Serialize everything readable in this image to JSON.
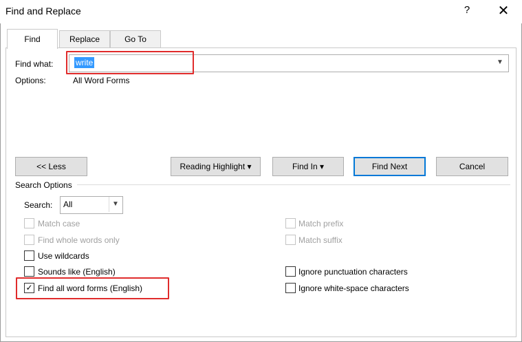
{
  "window": {
    "title": "Find and Replace",
    "help": "?",
    "close": "✕"
  },
  "tabs": [
    {
      "label": "Find",
      "active": true
    },
    {
      "label": "Replace",
      "active": false
    },
    {
      "label": "Go To",
      "active": false
    }
  ],
  "find": {
    "label": "Find what:",
    "value": "write",
    "options_label": "Options:",
    "options_value": "All Word Forms"
  },
  "buttons": {
    "less": "<< Less",
    "reading_highlight": "Reading Highlight",
    "find_in": "Find In",
    "find_next": "Find Next",
    "cancel": "Cancel"
  },
  "search_options": {
    "title": "Search Options",
    "search_label": "Search:",
    "search_value": "All",
    "left": [
      {
        "label": "Match case",
        "checked": false,
        "disabled": true
      },
      {
        "label": "Find whole words only",
        "checked": false,
        "disabled": true
      },
      {
        "label": "Use wildcards",
        "checked": false,
        "disabled": false
      },
      {
        "label": "Sounds like (English)",
        "checked": false,
        "disabled": false
      },
      {
        "label": "Find all word forms (English)",
        "checked": true,
        "disabled": false
      }
    ],
    "right": [
      {
        "label": "Match prefix",
        "checked": false,
        "disabled": true
      },
      {
        "label": "Match suffix",
        "checked": false,
        "disabled": true
      },
      {
        "label": "Ignore punctuation characters",
        "checked": false,
        "disabled": false
      },
      {
        "label": "Ignore white-space characters",
        "checked": false,
        "disabled": false
      }
    ]
  },
  "colors": {
    "highlight_box": "#e02b2b",
    "selection": "#3399ff",
    "default_button": "#0078d7"
  }
}
